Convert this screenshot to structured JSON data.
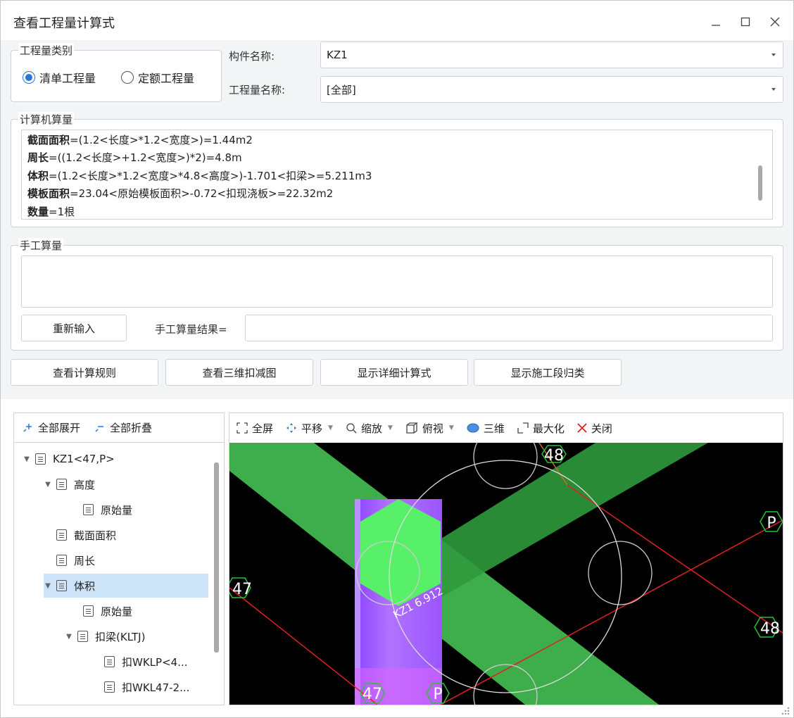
{
  "window": {
    "title": "查看工程量计算式"
  },
  "quantity_type": {
    "group_label": "工程量类别",
    "options": [
      {
        "label": "清单工程量",
        "checked": true
      },
      {
        "label": "定额工程量",
        "checked": false
      }
    ]
  },
  "component": {
    "label": "构件名称:",
    "value": "KZ1"
  },
  "quantity_name": {
    "label": "工程量名称:",
    "value": "[全部]"
  },
  "computer_calc": {
    "group_label": "计算机算量",
    "lines": [
      {
        "name": "截面面积",
        "expr": "=(1.2<长度>*1.2<宽度>)=1.44m2"
      },
      {
        "name": "周长",
        "expr": "=((1.2<长度>+1.2<宽度>)*2)=4.8m"
      },
      {
        "name": "体积",
        "expr": "=(1.2<长度>*1.2<宽度>*4.8<高度>)-1.701<扣梁>=5.211m3"
      },
      {
        "name": "模板面积",
        "expr": "=23.04<原始模板面积>-0.72<扣现浇板>=22.32m2"
      },
      {
        "name": "数量",
        "expr": "=1根"
      }
    ]
  },
  "manual_calc": {
    "group_label": "手工算量",
    "reenter_button": "重新输入",
    "result_label": "手工算量结果=",
    "result_value": ""
  },
  "actions": [
    "查看计算规则",
    "查看三维扣减图",
    "显示详细计算式",
    "显示施工段归类"
  ],
  "tree": {
    "expand_all": "全部展开",
    "collapse_all": "全部折叠",
    "items": [
      {
        "label": "KZ1<47,P>",
        "level": 0,
        "caret": "▼",
        "selected": false
      },
      {
        "label": "高度",
        "level": 1,
        "caret": "▼",
        "selected": false
      },
      {
        "label": "原始量",
        "level": 2,
        "caret": "",
        "selected": false
      },
      {
        "label": "截面面积",
        "level": 1,
        "caret": "",
        "selected": false
      },
      {
        "label": "周长",
        "level": 1,
        "caret": "",
        "selected": false
      },
      {
        "label": "体积",
        "level": 1,
        "caret": "▼",
        "selected": true
      },
      {
        "label": "原始量",
        "level": 2,
        "caret": "",
        "selected": false
      },
      {
        "label": "扣梁(KLTJ)",
        "level": 2,
        "caret": "▼",
        "selected": false
      },
      {
        "label": "扣WKLP<4...",
        "level": 3,
        "caret": "",
        "selected": false
      },
      {
        "label": "扣WKL47-2...",
        "level": 3,
        "caret": "",
        "selected": false
      }
    ]
  },
  "view_toolbar": {
    "fullscreen": "全屏",
    "pan": "平移",
    "zoom": "缩放",
    "top_view": "俯视",
    "three_d": "三维",
    "maximize": "最大化",
    "close": "关闭"
  },
  "scene_labels": {
    "axis_48_top": "48",
    "axis_p_right": "P",
    "axis_47_left": "47",
    "axis_48_right": "48",
    "axis_47_bottom": "47",
    "axis_p_bottom": "P",
    "column_tag": "KZ1 6.912"
  },
  "colors": {
    "accent": "#2a74d5",
    "selected_row": "#cde3f7",
    "beam_green": "#3fd65a",
    "column_purple": "#a060ff",
    "axis_red": "#e02020"
  }
}
